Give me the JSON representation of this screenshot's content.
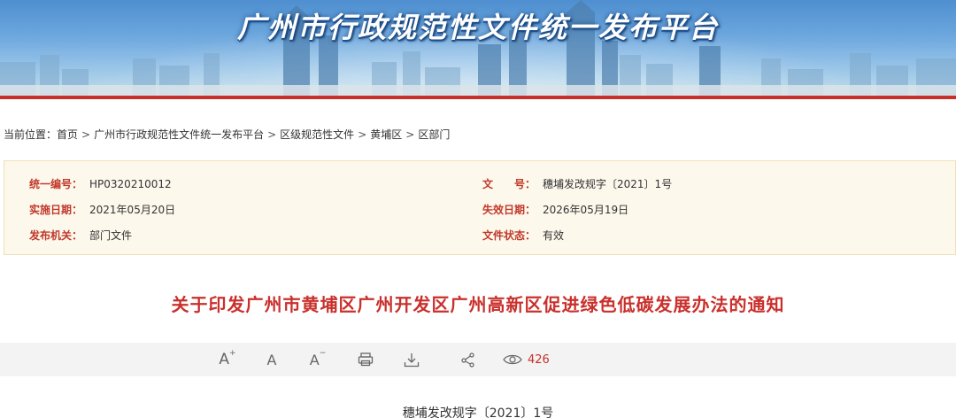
{
  "banner": {
    "title": "广州市行政规范性文件统一发布平台"
  },
  "breadcrumb": {
    "prefix": "当前位置：",
    "items": [
      "首页",
      "广州市行政规范性文件统一发布平台",
      "区级规范性文件",
      "黄埔区",
      "区部门"
    ],
    "separator": ">"
  },
  "info": {
    "serial_label": "统一编号：",
    "serial_value": "HP0320210012",
    "docno_label": "文　　号：",
    "docno_value": "穗埔发改规字〔2021〕1号",
    "effective_label": "实施日期：",
    "effective_value": "2021年05月20日",
    "expiry_label": "失效日期：",
    "expiry_value": "2026年05月19日",
    "issuer_label": "发布机关：",
    "issuer_value": "部门文件",
    "status_label": "文件状态：",
    "status_value": "有效"
  },
  "document": {
    "title": "关于印发广州市黄埔区广州开发区广州高新区促进绿色低碳发展办法的通知",
    "number": "穗埔发改规字〔2021〕1号"
  },
  "toolbar": {
    "font_large": "A",
    "font_large_sup": "+",
    "font_medium": "A",
    "font_small": "A",
    "font_small_sup": "−",
    "print_icon": "print-icon",
    "download_icon": "download-icon",
    "share_icon": "share-icon",
    "view_icon": "eye-icon",
    "view_count": "426"
  },
  "colors": {
    "accent_red": "#c9302c",
    "info_bg": "#fdf8ec",
    "toolbar_bg": "#f3f3f3"
  }
}
